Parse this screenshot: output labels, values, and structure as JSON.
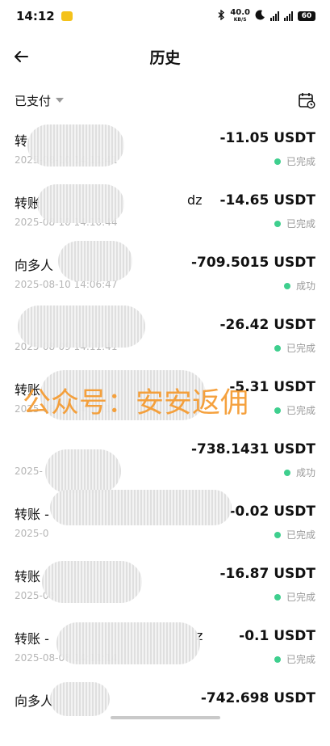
{
  "status_bar": {
    "time": "14:12",
    "net_speed": "40.0",
    "net_unit": "KB/S",
    "battery": "60"
  },
  "header": {
    "title": "历史"
  },
  "filter": {
    "label": "已支付"
  },
  "transactions": [
    {
      "title": "转",
      "date": "2025-08-10 14:11:41",
      "amount": "-11.05 USDT",
      "status": "已完成"
    },
    {
      "title": "转账",
      "title_suffix": "dz",
      "date": "2025-08-10 14:10:44",
      "amount": "-14.65 USDT",
      "status": "已完成"
    },
    {
      "title": "向多人",
      "date": "2025-08-10 14:06:47",
      "amount": "-709.5015 USDT",
      "status": "成功"
    },
    {
      "title": "",
      "date": "2025-08-09 14:11:41",
      "amount": "-26.42 USDT",
      "status": "已完成"
    },
    {
      "title": "转账",
      "date": "2025-08-09 14:11:13",
      "amount": "-5.31 USDT",
      "status": "已完成"
    },
    {
      "title": "",
      "date": "2025-",
      "amount": "-738.1431 USDT",
      "status": "成功"
    },
    {
      "title": "转账 -",
      "date": "2025-0",
      "amount": "-0.02 USDT",
      "status": "已完成"
    },
    {
      "title": "转账",
      "date": "2025-08",
      "amount": "-16.87 USDT",
      "status": "已完成"
    },
    {
      "title": "转账 -",
      "title_suffix": "z",
      "date": "2025-08-08 14:11:14",
      "amount": "-0.1 USDT",
      "status": "已完成"
    },
    {
      "title": "向多人",
      "date": "",
      "amount": "-742.698 USDT",
      "status": ""
    }
  ],
  "watermark": {
    "text": "公众号：安安返佣"
  },
  "colors": {
    "status_dot": "#3ecf8e",
    "watermark": "#f59a2e",
    "date_text": "#b6b6b6"
  }
}
